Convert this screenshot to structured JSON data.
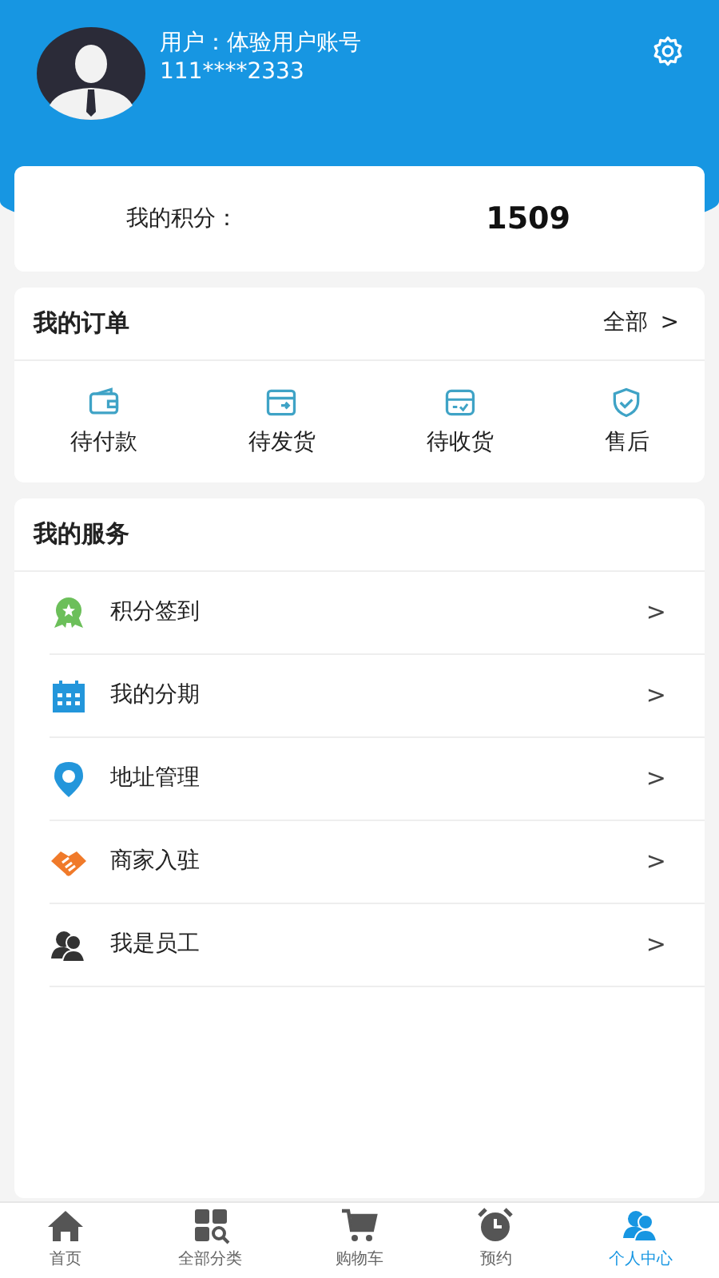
{
  "profile": {
    "name": "用户：体验用户账号",
    "phone": "111****2333"
  },
  "points": {
    "label": "我的积分：",
    "value": "1509"
  },
  "orders": {
    "title": "我的订单",
    "all": "全部",
    "more": ">",
    "items": [
      "待付款",
      "待发货",
      "待收货",
      "售后"
    ]
  },
  "services": {
    "title": "我的服务",
    "items": [
      {
        "label": "积分签到",
        "arrow": ">"
      },
      {
        "label": "我的分期",
        "arrow": ">"
      },
      {
        "label": "地址管理",
        "arrow": ">"
      },
      {
        "label": "商家入驻",
        "arrow": ">"
      },
      {
        "label": "我是员工",
        "arrow": ">"
      }
    ]
  },
  "tabbar": [
    {
      "label": "首页",
      "selected": false
    },
    {
      "label": "全部分类",
      "selected": false
    },
    {
      "label": "购物车",
      "selected": false
    },
    {
      "label": "预约",
      "selected": false
    },
    {
      "label": "个人中心",
      "selected": true
    }
  ]
}
